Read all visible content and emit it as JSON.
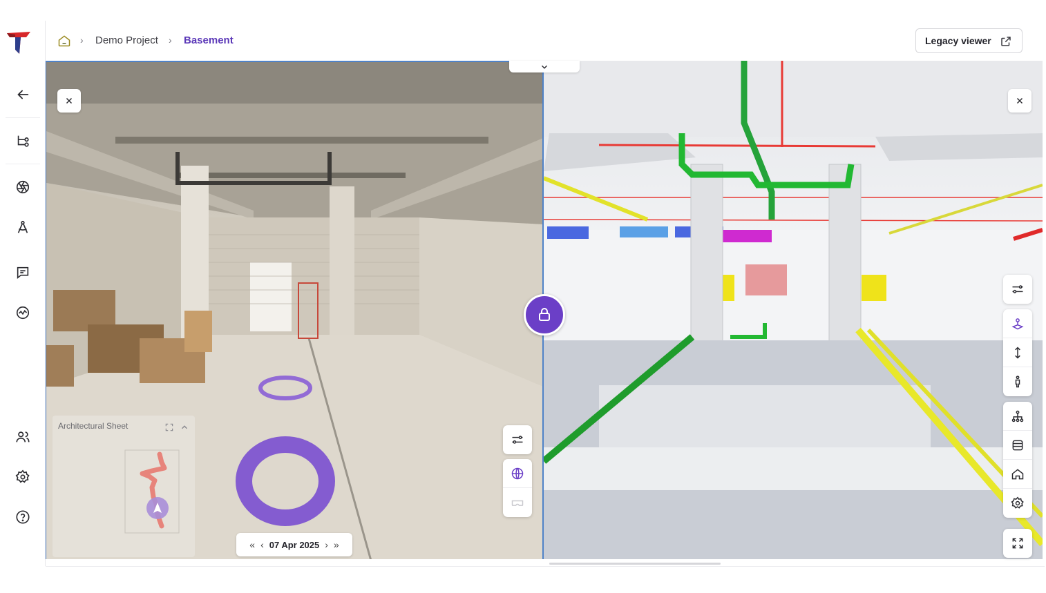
{
  "breadcrumb": {
    "items": [
      "Demo Project",
      "Basement"
    ]
  },
  "header": {
    "legacy_viewer_label": "Legacy viewer"
  },
  "minimap": {
    "title": "Architectural Sheet"
  },
  "date_selector": {
    "date": "07 Apr 2025",
    "first": "«",
    "prev": "‹",
    "next": "›",
    "last": "»"
  },
  "colors": {
    "accent": "#6b3fc7",
    "link": "#5b38b8",
    "divider": "#4f82c8"
  },
  "icons": {
    "sidebar": [
      "back-arrow-icon",
      "hierarchy-icon",
      "aperture-icon",
      "compass-icon",
      "comment-icon",
      "activity-icon",
      "users-icon",
      "settings-icon",
      "help-icon"
    ],
    "left_tools": [
      "sliders-icon",
      "globe-icon",
      "vr-headset-icon"
    ],
    "right_tools": [
      "sliders-icon",
      "joystick-icon",
      "elevation-icon",
      "person-icon",
      "tree-icon",
      "layers-icon",
      "home-icon",
      "gear-icon",
      "fullscreen-icon"
    ]
  }
}
